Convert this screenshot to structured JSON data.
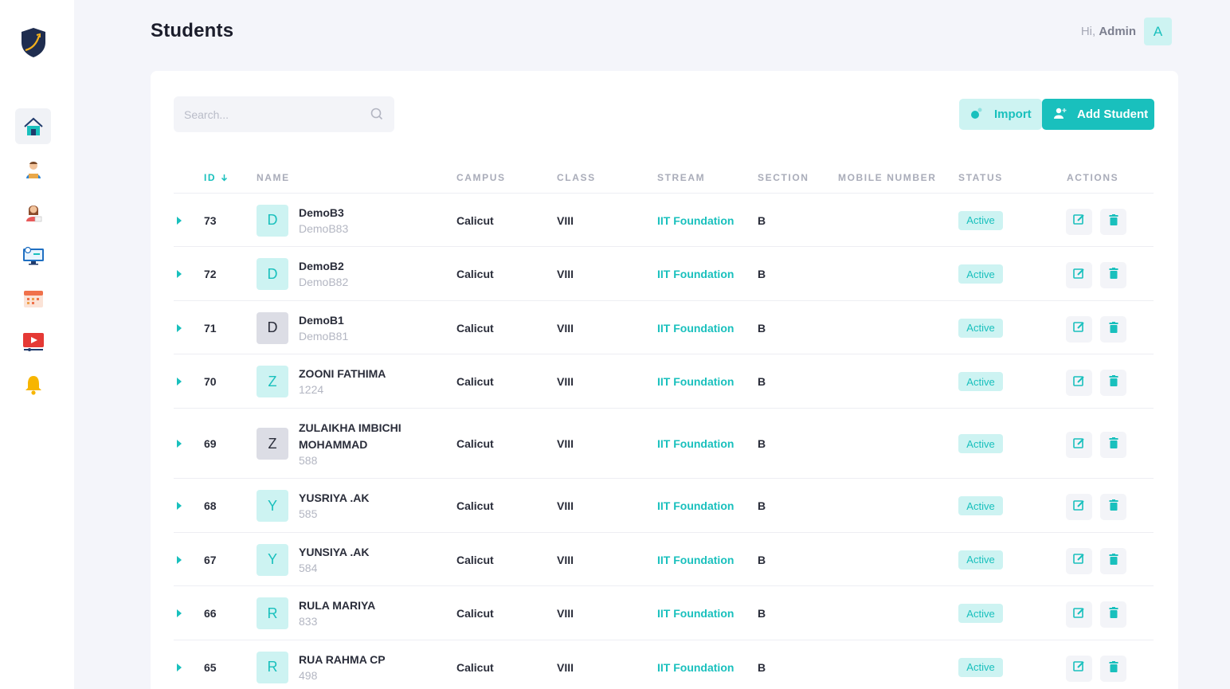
{
  "page": {
    "title": "Students"
  },
  "header": {
    "greeting": "Hi,",
    "user_name": "Admin",
    "avatar_letter": "A"
  },
  "sidebar": {
    "items": [
      {
        "name": "home-icon",
        "active": true
      },
      {
        "name": "student-icon",
        "active": false
      },
      {
        "name": "teacher-icon",
        "active": false
      },
      {
        "name": "monitor-icon",
        "active": false
      },
      {
        "name": "calendar-icon",
        "active": false
      },
      {
        "name": "video-icon",
        "active": false
      },
      {
        "name": "bell-icon",
        "active": false
      }
    ]
  },
  "search": {
    "placeholder": "Search...",
    "value": ""
  },
  "toolbar": {
    "import_label": "Import",
    "add_label": "Add Student"
  },
  "table": {
    "columns": [
      "ID",
      "NAME",
      "CAMPUS",
      "CLASS",
      "STREAM",
      "SECTION",
      "MOBILE NUMBER",
      "STATUS",
      "ACTIONS"
    ],
    "rows": [
      {
        "id": "73",
        "initial": "D",
        "avatar_style": "teal",
        "name": "DemoB3",
        "sub": "DemoB83",
        "campus": "Calicut",
        "class": "VIII",
        "stream": "IIT Foundation",
        "section": "B",
        "mobile": "",
        "status": "Active"
      },
      {
        "id": "72",
        "initial": "D",
        "avatar_style": "teal",
        "name": "DemoB2",
        "sub": "DemoB82",
        "campus": "Calicut",
        "class": "VIII",
        "stream": "IIT Foundation",
        "section": "B",
        "mobile": "",
        "status": "Active"
      },
      {
        "id": "71",
        "initial": "D",
        "avatar_style": "gray",
        "name": "DemoB1",
        "sub": "DemoB81",
        "campus": "Calicut",
        "class": "VIII",
        "stream": "IIT Foundation",
        "section": "B",
        "mobile": "",
        "status": "Active"
      },
      {
        "id": "70",
        "initial": "Z",
        "avatar_style": "teal",
        "name": "ZOONI FATHIMA",
        "sub": "1224",
        "campus": "Calicut",
        "class": "VIII",
        "stream": "IIT Foundation",
        "section": "B",
        "mobile": "",
        "status": "Active"
      },
      {
        "id": "69",
        "initial": "Z",
        "avatar_style": "gray",
        "name": "ZULAIKHA IMBICHI MOHAMMAD",
        "sub": "588",
        "campus": "Calicut",
        "class": "VIII",
        "stream": "IIT Foundation",
        "section": "B",
        "mobile": "",
        "status": "Active"
      },
      {
        "id": "68",
        "initial": "Y",
        "avatar_style": "teal",
        "name": "YUSRIYA .AK",
        "sub": "585",
        "campus": "Calicut",
        "class": "VIII",
        "stream": "IIT Foundation",
        "section": "B",
        "mobile": "",
        "status": "Active"
      },
      {
        "id": "67",
        "initial": "Y",
        "avatar_style": "teal",
        "name": "YUNSIYA .AK",
        "sub": "584",
        "campus": "Calicut",
        "class": "VIII",
        "stream": "IIT Foundation",
        "section": "B",
        "mobile": "",
        "status": "Active"
      },
      {
        "id": "66",
        "initial": "R",
        "avatar_style": "teal",
        "name": "RULA MARIYA",
        "sub": "833",
        "campus": "Calicut",
        "class": "VIII",
        "stream": "IIT Foundation",
        "section": "B",
        "mobile": "",
        "status": "Active"
      },
      {
        "id": "65",
        "initial": "R",
        "avatar_style": "teal",
        "name": "RUA RAHMA CP",
        "sub": "498",
        "campus": "Calicut",
        "class": "VIII",
        "stream": "IIT Foundation",
        "section": "B",
        "mobile": "",
        "status": "Active"
      }
    ]
  },
  "colors": {
    "accent": "#19c0bd",
    "accent_light": "#cdf3f2",
    "background": "#f4f5fa"
  }
}
